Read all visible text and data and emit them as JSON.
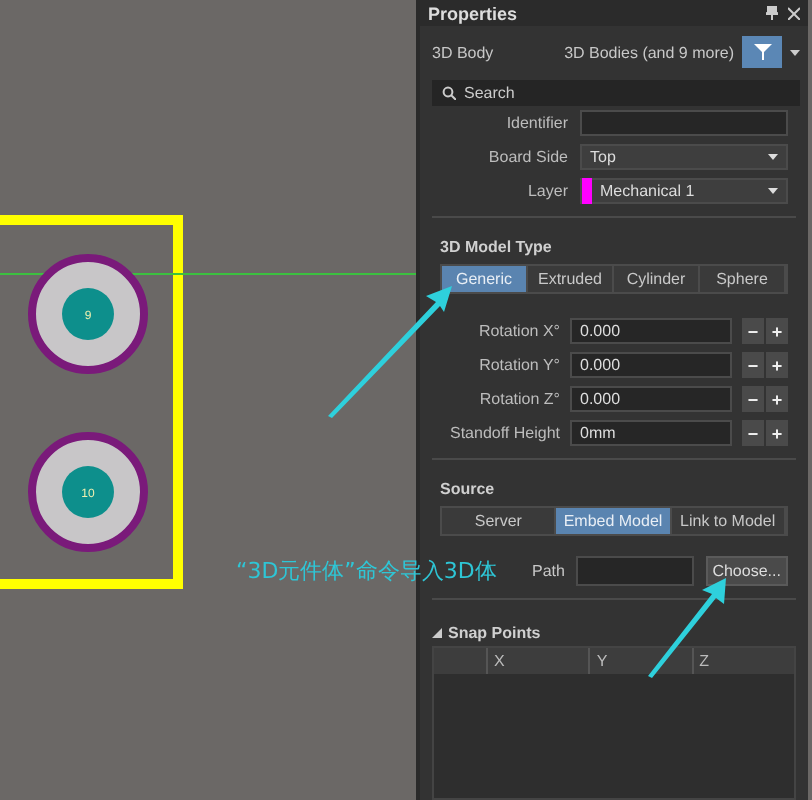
{
  "canvas": {
    "pads": [
      {
        "number": "9"
      },
      {
        "number": "10"
      }
    ]
  },
  "panel": {
    "title": "Properties",
    "object_type": "3D Body",
    "selection": "3D Bodies (and 9 more)",
    "search": {
      "placeholder": "Search"
    },
    "fields": [
      {
        "label": "Identifier",
        "kind": "text"
      },
      {
        "label": "Board Side",
        "kind": "dropdown",
        "value": "Top"
      },
      {
        "label": "Layer",
        "kind": "layer",
        "value": "Mechanical 1",
        "color": "#ff00ff"
      }
    ],
    "model_type": {
      "title": "3D Model Type",
      "options": [
        {
          "label": "Generic",
          "selected": true
        },
        {
          "label": "Extruded",
          "selected": false
        },
        {
          "label": "Cylinder",
          "selected": false
        },
        {
          "label": "Sphere",
          "selected": false
        }
      ]
    },
    "parameters": [
      {
        "label": "Rotation X°",
        "value": "0.000",
        "buttons": [
          "−",
          "+"
        ]
      },
      {
        "label": "Rotation Y°",
        "value": "0.000",
        "buttons": [
          "−",
          "+"
        ]
      },
      {
        "label": "Rotation Z°",
        "value": "0.000",
        "buttons": [
          "−",
          "+"
        ]
      },
      {
        "label": "Standoff Height",
        "value": "0mm",
        "buttons": [
          "−",
          "+"
        ]
      }
    ],
    "source": {
      "title": "Source",
      "options": [
        {
          "label": "Server",
          "selected": false
        },
        {
          "label": "Embed Model",
          "selected": true
        },
        {
          "label": "Link to Model",
          "selected": false
        }
      ],
      "path_label": "Path",
      "choose_button": "Choose..."
    },
    "snap_points": {
      "title": "Snap Points",
      "expanded": true,
      "columns": [
        "X",
        "Y",
        "Z"
      ]
    }
  },
  "annotation": "“3D元件体”命令导入3D体"
}
